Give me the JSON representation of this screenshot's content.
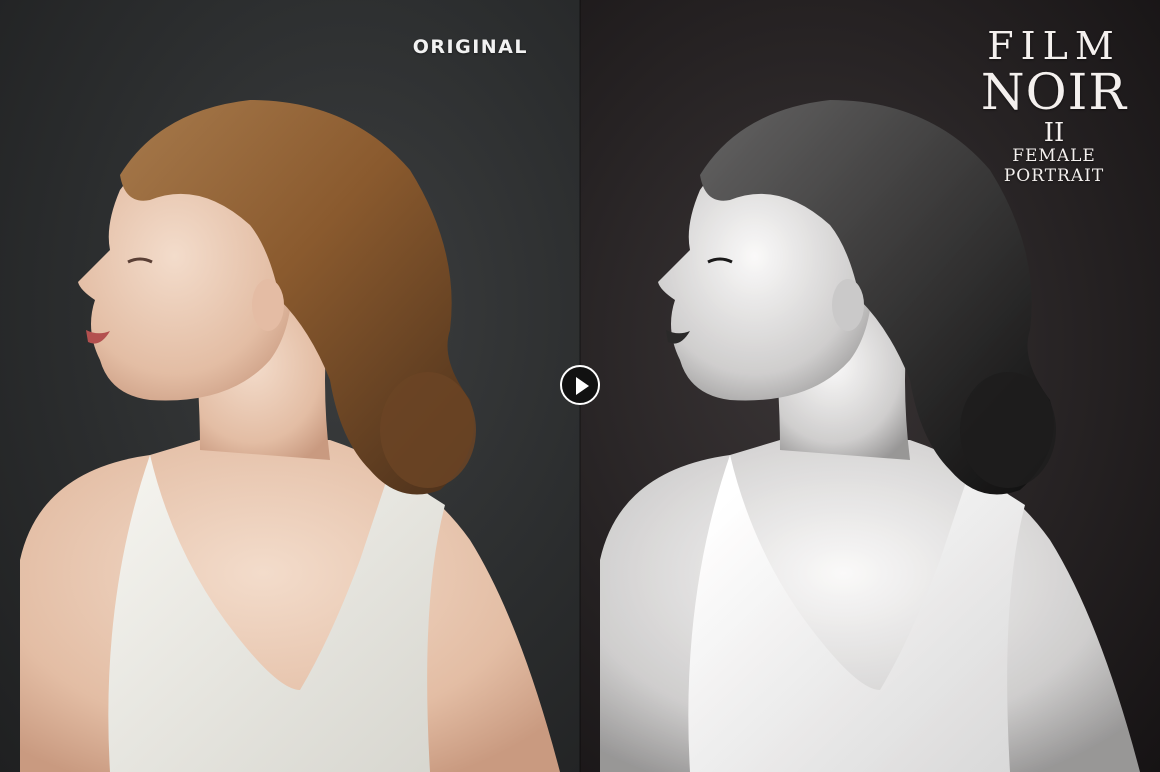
{
  "labels": {
    "original": "ORIGINAL",
    "title_line1": "FILM",
    "title_line2": "NOIR",
    "title_numeral": "II",
    "subtitle_line1": "FEMALE",
    "subtitle_line2": "PORTRAIT"
  },
  "compare_control": {
    "icon": "play-icon"
  },
  "colors": {
    "label_text": "#f2f2f2",
    "title_text": "#f4f0ee",
    "hair_original": "#8a5a2e",
    "dress": "#ecebe6",
    "skin": "#e8c7b0"
  }
}
